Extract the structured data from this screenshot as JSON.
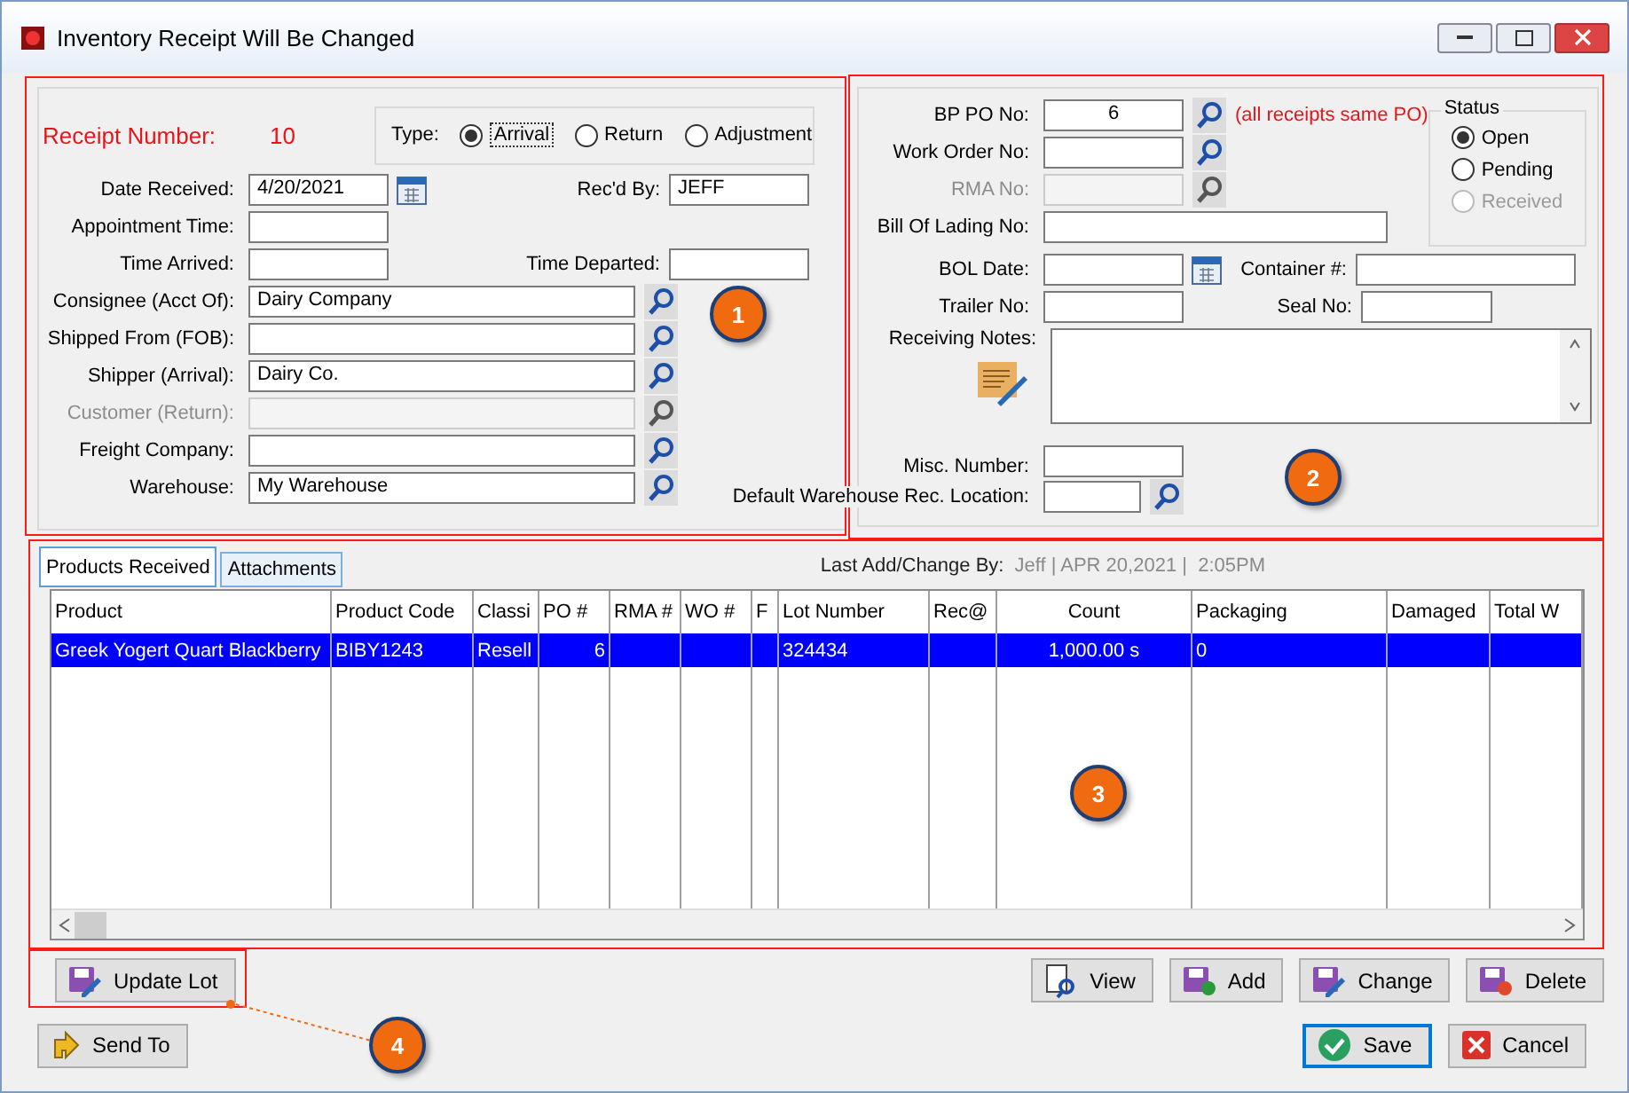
{
  "window": {
    "title": "Inventory Receipt Will Be Changed"
  },
  "receipt": {
    "label": "Receipt Number:",
    "value": "10"
  },
  "type": {
    "label": "Type:",
    "options": [
      {
        "label": "Arrival",
        "selected": true
      },
      {
        "label": "Return",
        "selected": false
      },
      {
        "label": "Adjustment",
        "selected": false
      }
    ]
  },
  "left_rows": [
    {
      "kind": "date",
      "label": "Date Received:",
      "value": "4/20/2021",
      "disabled": false,
      "side": {
        "label": "Rec'd By:",
        "value": "JEFF"
      }
    },
    {
      "kind": "short",
      "label": "Appointment Time:",
      "disabled": false
    },
    {
      "kind": "short",
      "label": "Time Arrived:",
      "disabled": false,
      "side": {
        "label": "Time Departed:"
      }
    },
    {
      "kind": "lookup",
      "label": "Consignee (Acct Of):",
      "value": "Dairy Company",
      "disabled": false
    },
    {
      "kind": "lookup",
      "label": "Shipped From (FOB):",
      "disabled": false
    },
    {
      "kind": "lookup",
      "label": "Shipper (Arrival):",
      "value": "Dairy Co.",
      "disabled": false
    },
    {
      "kind": "lookup",
      "label": "Customer (Return):",
      "disabled": true
    },
    {
      "kind": "lookup",
      "label": "Freight Company:",
      "disabled": false
    },
    {
      "kind": "lookup",
      "label": "Warehouse:",
      "value": "My Warehouse",
      "disabled": false
    }
  ],
  "right_top": [
    {
      "kind": "lookup",
      "label": "BP PO No:",
      "value": "6",
      "note": "(all receipts same PO)",
      "disabled": false
    },
    {
      "kind": "lookup",
      "label": "Work Order No:",
      "disabled": false
    },
    {
      "kind": "lookup",
      "label": "RMA No:",
      "disabled": true
    },
    {
      "kind": "wide",
      "label": "Bill Of Lading No:",
      "disabled": false
    }
  ],
  "status": {
    "label": "Status",
    "options": [
      {
        "label": "Open",
        "selected": true,
        "disabled": false
      },
      {
        "label": "Pending",
        "selected": false,
        "disabled": false
      },
      {
        "label": "Received",
        "selected": false,
        "disabled": true
      }
    ]
  },
  "right_bottom": [
    {
      "kind": "date",
      "label": "BOL Date:",
      "side": {
        "label": "Container #:",
        "kind": "long"
      }
    },
    {
      "kind": "short",
      "label": "Trailer No:",
      "side": {
        "label": "Seal No:",
        "kind": "short"
      }
    },
    {
      "kind": "notes",
      "label": "Receiving Notes:"
    },
    {
      "kind": "short",
      "label": "Misc. Number:"
    },
    {
      "kind": "lookup",
      "label": "Default Warehouse Rec. Location:"
    }
  ],
  "tabs": [
    {
      "label": "Products Received",
      "selected": true
    },
    {
      "label": "Attachments",
      "selected": false
    }
  ],
  "last_change": {
    "label": "Last Add/Change By:",
    "value": "Jeff | APR 20,2021 |  2:05PM"
  },
  "table": {
    "columns": [
      "Product",
      "Product Code",
      "Classi",
      "PO #",
      "RMA #",
      "WO #",
      "F",
      "Lot Number",
      "Rec@",
      "Count",
      "Packaging",
      "Damaged",
      "Total W"
    ],
    "rows": [
      {
        "selected": true,
        "cells": [
          "Greek Yogert Quart Blackberry",
          "BIBY1243",
          "Resell",
          "6",
          null,
          null,
          null,
          "324434",
          null,
          "1,000.00 s",
          "0",
          null,
          null
        ]
      }
    ]
  },
  "grid_buttons": [
    {
      "kind": "update",
      "label": "Update Lot"
    },
    {
      "kind": "view",
      "label": "View"
    },
    {
      "kind": "add",
      "label": "Add"
    },
    {
      "kind": "change",
      "label": "Change"
    },
    {
      "kind": "delete",
      "label": "Delete"
    }
  ],
  "footer_buttons": [
    {
      "kind": "send",
      "label": "Send To",
      "default": false
    },
    {
      "kind": "save",
      "label": "Save",
      "default": true
    },
    {
      "kind": "cancel",
      "label": "Cancel",
      "default": false
    }
  ],
  "annotations": [
    {
      "label": "1"
    },
    {
      "label": "2"
    },
    {
      "label": "3"
    },
    {
      "label": "4"
    }
  ]
}
